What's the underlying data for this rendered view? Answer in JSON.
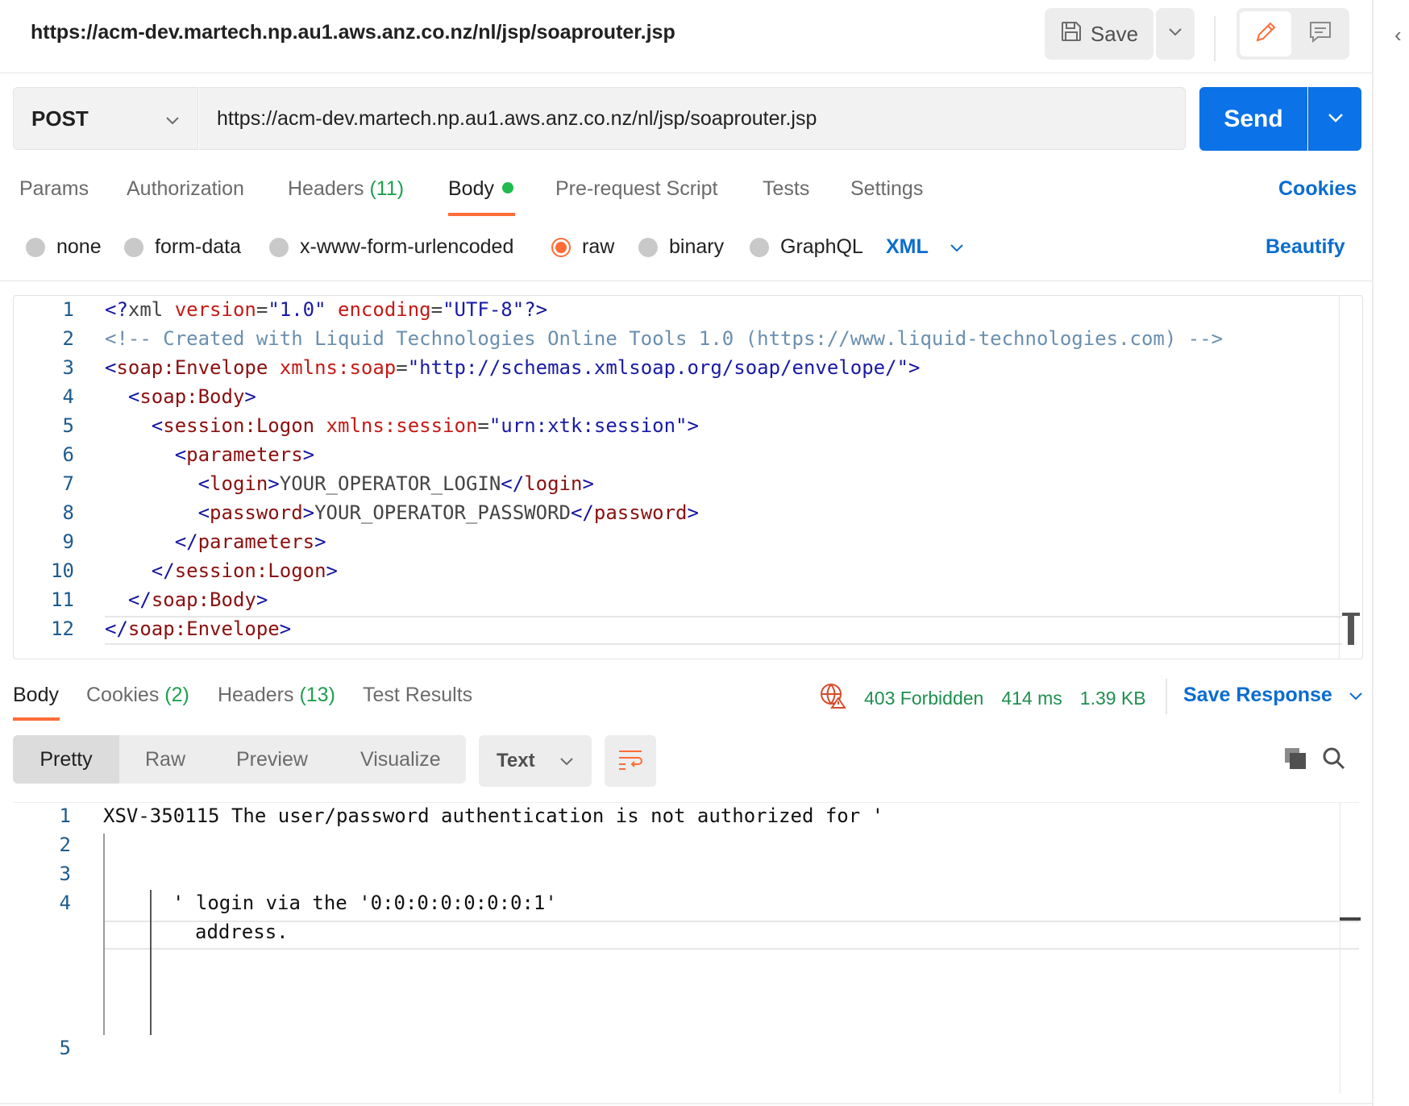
{
  "header": {
    "title": "https://acm-dev.martech.np.au1.aws.anz.co.nz/nl/jsp/soaprouter.jsp",
    "save_label": "Save"
  },
  "request": {
    "method": "POST",
    "url": "https://acm-dev.martech.np.au1.aws.anz.co.nz/nl/jsp/soaprouter.jsp",
    "send_label": "Send"
  },
  "tabs": {
    "params": "Params",
    "authorization": "Authorization",
    "headers": "Headers",
    "headers_count": "(11)",
    "body": "Body",
    "prerequest": "Pre-request Script",
    "tests": "Tests",
    "settings": "Settings",
    "cookies": "Cookies"
  },
  "body_types": {
    "none": "none",
    "form_data": "form-data",
    "urlencoded": "x-www-form-urlencoded",
    "raw": "raw",
    "binary": "binary",
    "graphql": "GraphQL",
    "language": "XML",
    "beautify": "Beautify",
    "selected": "raw"
  },
  "editor": {
    "line_numbers": [
      "1",
      "2",
      "3",
      "4",
      "5",
      "6",
      "7",
      "8",
      "9",
      "10",
      "11",
      "12"
    ],
    "lines": [
      [
        {
          "c": "t",
          "v": "<?"
        },
        {
          "c": "p",
          "v": "xml "
        },
        {
          "c": "a",
          "v": "version"
        },
        {
          "c": "p",
          "v": "="
        },
        {
          "c": "s",
          "v": "\"1.0\""
        },
        {
          "c": "p",
          "v": " "
        },
        {
          "c": "a",
          "v": "encoding"
        },
        {
          "c": "p",
          "v": "="
        },
        {
          "c": "s",
          "v": "\"UTF-8\""
        },
        {
          "c": "t",
          "v": "?>"
        }
      ],
      [
        {
          "c": "c",
          "v": "<!-- Created with Liquid Technologies Online Tools 1.0 (https://www.liquid-technologies.com) -->"
        }
      ],
      [
        {
          "c": "t",
          "v": "<"
        },
        {
          "c": "n",
          "v": "soap:Envelope"
        },
        {
          "c": "p",
          "v": " "
        },
        {
          "c": "a",
          "v": "xmlns:soap"
        },
        {
          "c": "p",
          "v": "="
        },
        {
          "c": "s",
          "v": "\"http://schemas.xmlsoap.org/soap/envelope/\""
        },
        {
          "c": "t",
          "v": ">"
        }
      ],
      [
        {
          "c": "p",
          "v": "  "
        },
        {
          "c": "t",
          "v": "<"
        },
        {
          "c": "n",
          "v": "soap:Body"
        },
        {
          "c": "t",
          "v": ">"
        }
      ],
      [
        {
          "c": "p",
          "v": "    "
        },
        {
          "c": "t",
          "v": "<"
        },
        {
          "c": "n",
          "v": "session:Logon"
        },
        {
          "c": "p",
          "v": " "
        },
        {
          "c": "a",
          "v": "xmlns:session"
        },
        {
          "c": "p",
          "v": "="
        },
        {
          "c": "s",
          "v": "\"urn:xtk:session\""
        },
        {
          "c": "t",
          "v": ">"
        }
      ],
      [
        {
          "c": "p",
          "v": "      "
        },
        {
          "c": "t",
          "v": "<"
        },
        {
          "c": "n",
          "v": "parameters"
        },
        {
          "c": "t",
          "v": ">"
        }
      ],
      [
        {
          "c": "p",
          "v": "        "
        },
        {
          "c": "t",
          "v": "<"
        },
        {
          "c": "n",
          "v": "login"
        },
        {
          "c": "t",
          "v": ">"
        },
        {
          "c": "p",
          "v": "YOUR_OPERATOR_LOGIN"
        },
        {
          "c": "t",
          "v": "</"
        },
        {
          "c": "n",
          "v": "login"
        },
        {
          "c": "t",
          "v": ">"
        }
      ],
      [
        {
          "c": "p",
          "v": "        "
        },
        {
          "c": "t",
          "v": "<"
        },
        {
          "c": "n",
          "v": "password"
        },
        {
          "c": "t",
          "v": ">"
        },
        {
          "c": "p",
          "v": "YOUR_OPERATOR_PASSWORD"
        },
        {
          "c": "t",
          "v": "</"
        },
        {
          "c": "n",
          "v": "password"
        },
        {
          "c": "t",
          "v": ">"
        }
      ],
      [
        {
          "c": "p",
          "v": "      "
        },
        {
          "c": "t",
          "v": "</"
        },
        {
          "c": "n",
          "v": "parameters"
        },
        {
          "c": "t",
          "v": ">"
        }
      ],
      [
        {
          "c": "p",
          "v": "    "
        },
        {
          "c": "t",
          "v": "</"
        },
        {
          "c": "n",
          "v": "session:Logon"
        },
        {
          "c": "t",
          "v": ">"
        }
      ],
      [
        {
          "c": "p",
          "v": "  "
        },
        {
          "c": "t",
          "v": "</"
        },
        {
          "c": "n",
          "v": "soap:Body"
        },
        {
          "c": "t",
          "v": ">"
        }
      ],
      [
        {
          "c": "t",
          "v": "</"
        },
        {
          "c": "n",
          "v": "soap:Envelope"
        },
        {
          "c": "t",
          "v": ">"
        }
      ]
    ]
  },
  "response": {
    "tabs": {
      "body": "Body",
      "cookies": "Cookies",
      "cookies_count": "(2)",
      "headers": "Headers",
      "headers_count": "(13)",
      "test_results": "Test Results"
    },
    "status": "403 Forbidden",
    "time": "414 ms",
    "size": "1.39 KB",
    "save_response": "Save Response",
    "views": {
      "pretty": "Pretty",
      "raw": "Raw",
      "preview": "Preview",
      "visualize": "Visualize"
    },
    "format": "Text",
    "line_numbers": [
      "1",
      "2",
      "3",
      "4",
      "5"
    ],
    "text": {
      "line1": "XSV-350115 The user/password authentication is not authorized for '",
      "line4a": "' login via the '0:0:0:0:0:0:0:1'",
      "line4b": "address."
    }
  },
  "colors": {
    "accent": "#ff6c37",
    "primary": "#0b72e7",
    "link": "#0b6ccf",
    "success": "#1f9f4f",
    "error_icon": "#d64c2c"
  }
}
